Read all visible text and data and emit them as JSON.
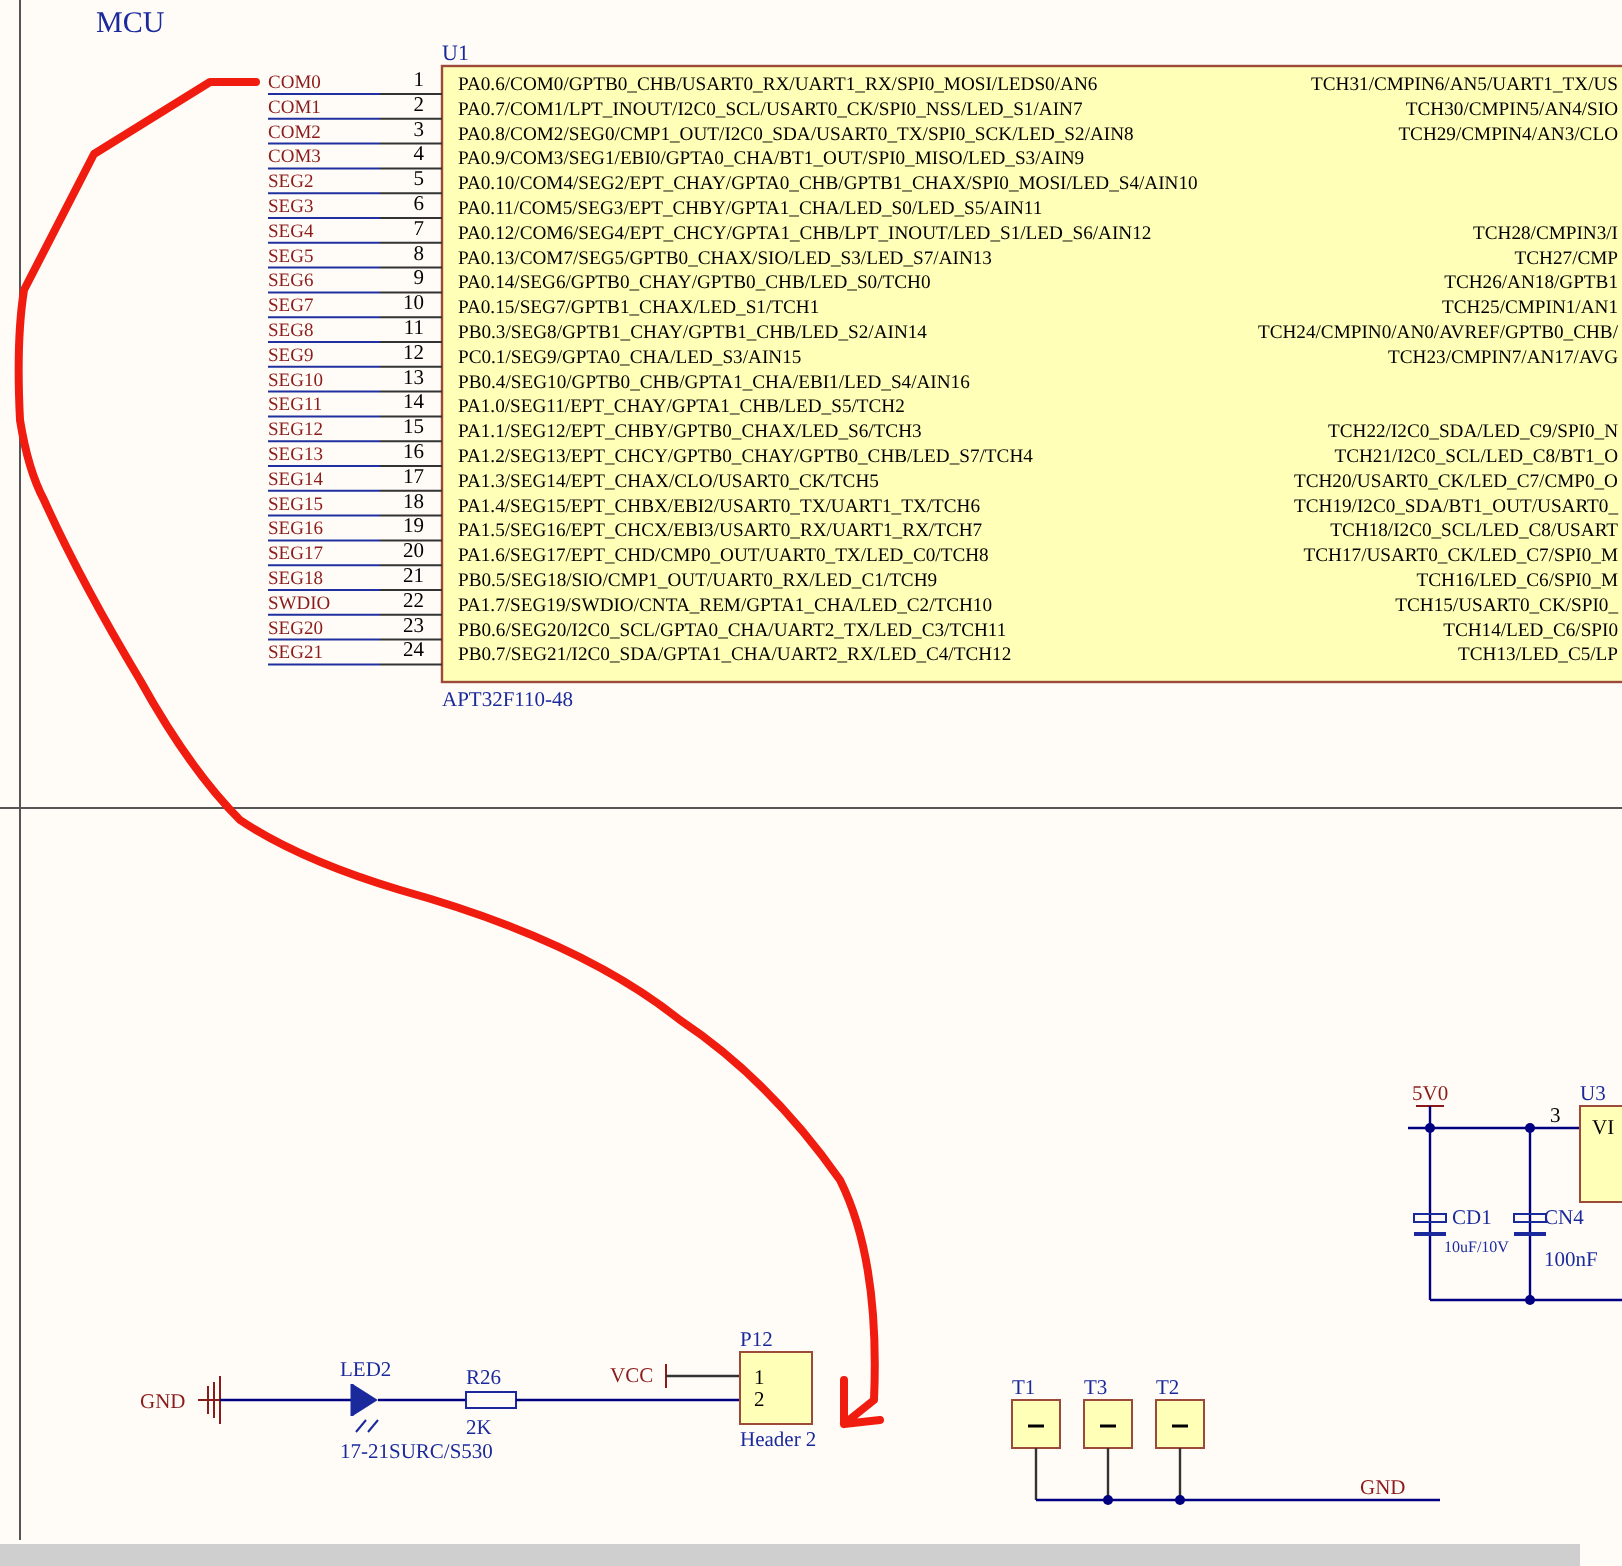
{
  "sheet_title": "MCU",
  "chip": {
    "designator": "U1",
    "part": "APT32F110-48",
    "pins": [
      {
        "net": "COM0",
        "number": "1",
        "function": "PA0.6/COM0/GPTB0_CHB/USART0_RX/UART1_RX/SPI0_MOSI/LEDS0/AN6",
        "right_function": "TCH31/CMPIN6/AN5/UART1_TX/US"
      },
      {
        "net": "COM1",
        "number": "2",
        "function": "PA0.7/COM1/LPT_INOUT/I2C0_SCL/USART0_CK/SPI0_NSS/LED_S1/AIN7",
        "right_function": "TCH30/CMPIN5/AN4/SIO"
      },
      {
        "net": "COM2",
        "number": "3",
        "function": "PA0.8/COM2/SEG0/CMP1_OUT/I2C0_SDA/USART0_TX/SPI0_SCK/LED_S2/AIN8",
        "right_function": "TCH29/CMPIN4/AN3/CLO"
      },
      {
        "net": "COM3",
        "number": "4",
        "function": "PA0.9/COM3/SEG1/EBI0/GPTA0_CHA/BT1_OUT/SPI0_MISO/LED_S3/AIN9"
      },
      {
        "net": "SEG2",
        "number": "5",
        "function": "PA0.10/COM4/SEG2/EPT_CHAY/GPTA0_CHB/GPTB1_CHAX/SPI0_MOSI/LED_S4/AIN10"
      },
      {
        "net": "SEG3",
        "number": "6",
        "function": "PA0.11/COM5/SEG3/EPT_CHBY/GPTA1_CHA/LED_S0/LED_S5/AIN11"
      },
      {
        "net": "SEG4",
        "number": "7",
        "function": "PA0.12/COM6/SEG4/EPT_CHCY/GPTA1_CHB/LPT_INOUT/LED_S1/LED_S6/AIN12",
        "right_function": "TCH28/CMPIN3/I"
      },
      {
        "net": "SEG5",
        "number": "8",
        "function": "PA0.13/COM7/SEG5/GPTB0_CHAX/SIO/LED_S3/LED_S7/AIN13",
        "right_function": "TCH27/CMP"
      },
      {
        "net": "SEG6",
        "number": "9",
        "function": "PA0.14/SEG6/GPTB0_CHAY/GPTB0_CHB/LED_S0/TCH0",
        "right_function": "TCH26/AN18/GPTB1"
      },
      {
        "net": "SEG7",
        "number": "10",
        "function": "PA0.15/SEG7/GPTB1_CHAX/LED_S1/TCH1",
        "right_function": "TCH25/CMPIN1/AN1"
      },
      {
        "net": "SEG8",
        "number": "11",
        "function": "PB0.3/SEG8/GPTB1_CHAY/GPTB1_CHB/LED_S2/AIN14",
        "right_function": "TCH24/CMPIN0/AN0/AVREF/GPTB0_CHB/"
      },
      {
        "net": "SEG9",
        "number": "12",
        "function": "PC0.1/SEG9/GPTA0_CHA/LED_S3/AIN15",
        "right_function": "TCH23/CMPIN7/AN17/AVG"
      },
      {
        "net": "SEG10",
        "number": "13",
        "function": "PB0.4/SEG10/GPTB0_CHB/GPTA1_CHA/EBI1/LED_S4/AIN16"
      },
      {
        "net": "SEG11",
        "number": "14",
        "function": "PA1.0/SEG11/EPT_CHAY/GPTA1_CHB/LED_S5/TCH2"
      },
      {
        "net": "SEG12",
        "number": "15",
        "function": "PA1.1/SEG12/EPT_CHBY/GPTB0_CHAX/LED_S6/TCH3",
        "right_function": "TCH22/I2C0_SDA/LED_C9/SPI0_N"
      },
      {
        "net": "SEG13",
        "number": "16",
        "function": "PA1.2/SEG13/EPT_CHCY/GPTB0_CHAY/GPTB0_CHB/LED_S7/TCH4",
        "right_function": "TCH21/I2C0_SCL/LED_C8/BT1_O"
      },
      {
        "net": "SEG14",
        "number": "17",
        "function": "PA1.3/SEG14/EPT_CHAX/CLO/USART0_CK/TCH5",
        "right_function": "TCH20/USART0_CK/LED_C7/CMP0_O"
      },
      {
        "net": "SEG15",
        "number": "18",
        "function": "PA1.4/SEG15/EPT_CHBX/EBI2/USART0_TX/UART1_TX/TCH6",
        "right_function": "TCH19/I2C0_SDA/BT1_OUT/USART0_"
      },
      {
        "net": "SEG16",
        "number": "19",
        "function": "PA1.5/SEG16/EPT_CHCX/EBI3/USART0_RX/UART1_RX/TCH7",
        "right_function": "TCH18/I2C0_SCL/LED_C8/USART"
      },
      {
        "net": "SEG17",
        "number": "20",
        "function": "PA1.6/SEG17/EPT_CHD/CMP0_OUT/UART0_TX/LED_C0/TCH8",
        "right_function": "TCH17/USART0_CK/LED_C7/SPI0_M"
      },
      {
        "net": "SEG18",
        "number": "21",
        "function": "PB0.5/SEG18/SIO/CMP1_OUT/UART0_RX/LED_C1/TCH9",
        "right_function": "TCH16/LED_C6/SPI0_M"
      },
      {
        "net": "SWDIO",
        "number": "22",
        "function": "PA1.7/SEG19/SWDIO/CNTA_REM/GPTA1_CHA/LED_C2/TCH10",
        "right_function": "TCH15/USART0_CK/SPI0_"
      },
      {
        "net": "SEG20",
        "number": "23",
        "function": "PB0.6/SEG20/I2C0_SCL/GPTA0_CHA/UART2_TX/LED_C3/TCH11",
        "right_function": "TCH14/LED_C6/SPI0"
      },
      {
        "net": "SEG21",
        "number": "24",
        "function": "PB0.7/SEG21/I2C0_SDA/GPTA1_CHA/UART2_RX/LED_C4/TCH12",
        "right_function": "TCH13/LED_C5/LP"
      }
    ]
  },
  "power": {
    "net": "5V0",
    "regulator": "U3",
    "regulator_pin": "3",
    "regulator_pin_label": "VI",
    "capacitors": [
      {
        "designator": "CD1",
        "value": "10uF/10V"
      },
      {
        "designator": "CN4",
        "value": "100nF"
      }
    ]
  },
  "led_circuit": {
    "gnd": "GND",
    "led": {
      "designator": "LED2",
      "part": "17-21SURC/S530"
    },
    "resistor": {
      "designator": "R26",
      "value": "2K"
    },
    "vcc": "VCC",
    "header": {
      "designator": "P12",
      "pins": [
        "1",
        "2"
      ],
      "part": "Header 2"
    }
  },
  "test_points": {
    "points": [
      {
        "designator": "T1"
      },
      {
        "designator": "T3"
      },
      {
        "designator": "T2"
      }
    ],
    "gnd": "GND"
  }
}
